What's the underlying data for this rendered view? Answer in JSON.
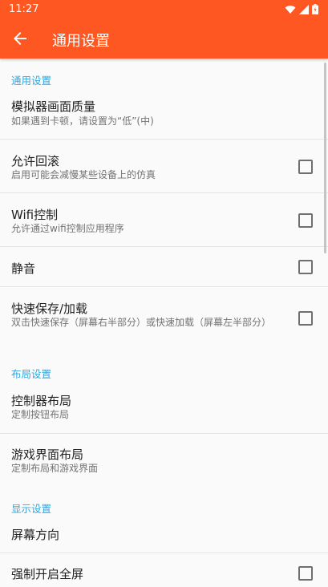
{
  "status_bar": {
    "time": "11:27",
    "icons": [
      "wifi-icon",
      "signal-icon",
      "battery-icon"
    ]
  },
  "app_bar": {
    "back_icon": "arrow-back-icon",
    "title": "通用设置"
  },
  "colors": {
    "accent": "#ff5722",
    "category": "#33a6de",
    "text": "#212121",
    "subtext": "#737373"
  },
  "sections": [
    {
      "header": "通用设置",
      "items": [
        {
          "title": "模拟器画面质量",
          "subtitle": "如果遇到卡顿，请设置为“低”(中)",
          "checkbox": null
        },
        {
          "title": "允许回滚",
          "subtitle": "启用可能会减慢某些设备上的仿真",
          "checkbox": false
        },
        {
          "title": "Wifi控制",
          "subtitle": "允许通过wifi控制应用程序",
          "checkbox": false
        },
        {
          "title": "静音",
          "subtitle": "",
          "checkbox": false
        },
        {
          "title": "快速保存/加载",
          "subtitle": "双击快速保存（屏幕右半部分）或快速加载（屏幕左半部分）",
          "checkbox": false
        }
      ]
    },
    {
      "header": "布局设置",
      "items": [
        {
          "title": "控制器布局",
          "subtitle": "定制按钮布局",
          "checkbox": null
        },
        {
          "title": "游戏界面布局",
          "subtitle": "定制布局和游戏界面",
          "checkbox": null
        }
      ]
    },
    {
      "header": "显示设置",
      "items": [
        {
          "title": "屏幕方向",
          "subtitle": "",
          "checkbox": null
        },
        {
          "title": "强制开启全屏",
          "subtitle": "",
          "checkbox": false
        }
      ]
    }
  ]
}
